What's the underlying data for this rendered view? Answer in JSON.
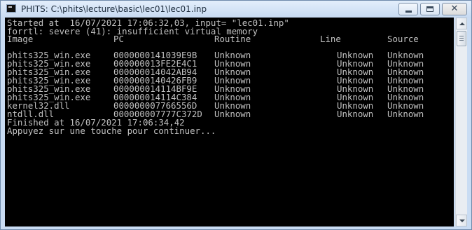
{
  "window": {
    "title": "PHITS: C:\\phits\\lecture\\basic\\lec01\\lec01.inp",
    "app_icon": "console-icon",
    "controls": {
      "minimize": "minimize-icon",
      "maximize": "maximize-icon",
      "close": "✕"
    }
  },
  "console": {
    "started_line": "Started at  16/07/2021 17:06:32,03, input= \"lec01.inp\"",
    "error_line": "forrtl: severe (41): insufficient virtual memory",
    "headers": {
      "image": "Image",
      "pc": "PC",
      "routine": "Routine",
      "line": "Line",
      "source": "Source"
    },
    "rows": [
      {
        "image": "phits325_win.exe",
        "pc": "0000000141039E9B",
        "routine": "Unknown",
        "line": "Unknown",
        "source": "Unknown"
      },
      {
        "image": "phits325_win.exe",
        "pc": "000000013FE2E4C1",
        "routine": "Unknown",
        "line": "Unknown",
        "source": "Unknown"
      },
      {
        "image": "phits325_win.exe",
        "pc": "000000014042AB94",
        "routine": "Unknown",
        "line": "Unknown",
        "source": "Unknown"
      },
      {
        "image": "phits325_win.exe",
        "pc": "0000000140426FB9",
        "routine": "Unknown",
        "line": "Unknown",
        "source": "Unknown"
      },
      {
        "image": "phits325_win.exe",
        "pc": "000000014114BF9E",
        "routine": "Unknown",
        "line": "Unknown",
        "source": "Unknown"
      },
      {
        "image": "phits325_win.exe",
        "pc": "000000014114C384",
        "routine": "Unknown",
        "line": "Unknown",
        "source": "Unknown"
      },
      {
        "image": "kernel32.dll",
        "pc": "000000007766556D",
        "routine": "Unknown",
        "line": "Unknown",
        "source": "Unknown"
      },
      {
        "image": "ntdll.dll",
        "pc": "000000007777C372D",
        "routine": "Unknown",
        "line": "Unknown",
        "source": "Unknown"
      }
    ],
    "finished_line": "Finished at 16/07/2021 17:06:34,42",
    "prompt_line": "Appuyez sur une touche pour continuer..."
  },
  "colors": {
    "console_bg": "#000000",
    "console_text": "#c0c0c0",
    "titlebar": "#c9dcf3"
  }
}
